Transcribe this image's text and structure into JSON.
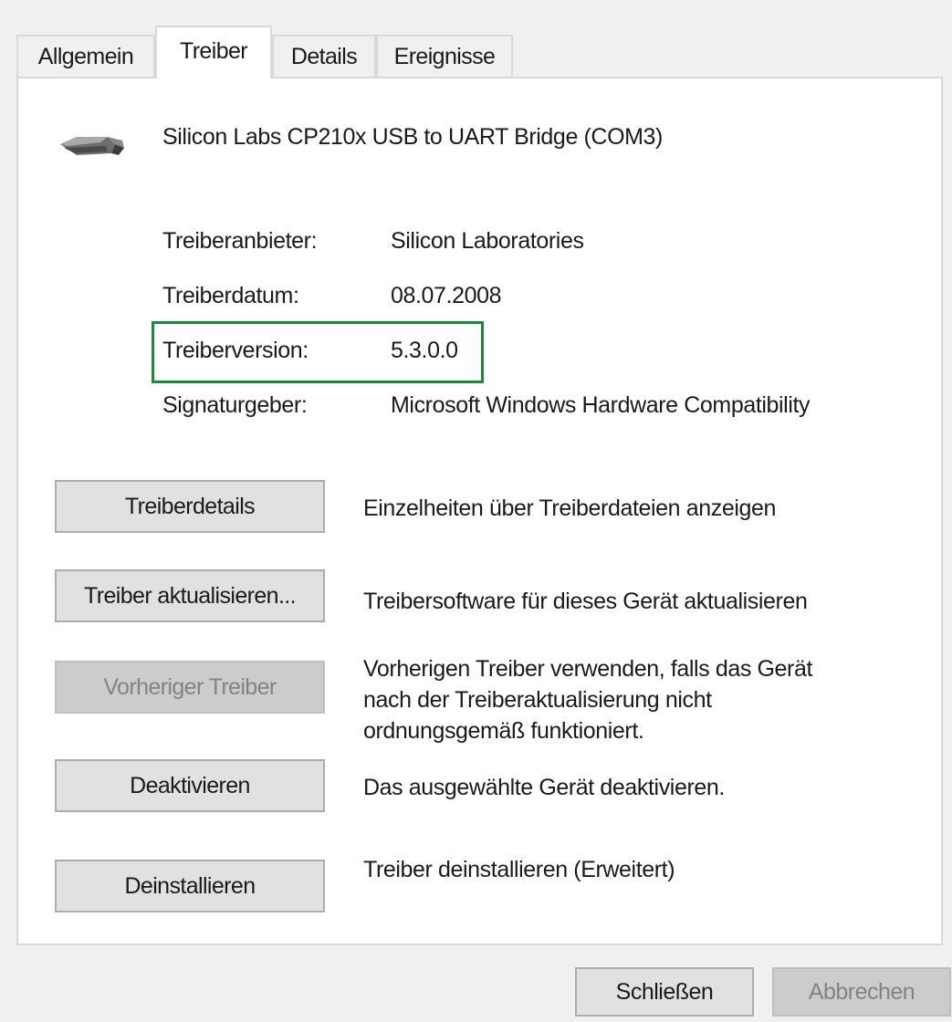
{
  "tabs": [
    {
      "label": "Allgemein"
    },
    {
      "label": "Treiber"
    },
    {
      "label": "Details"
    },
    {
      "label": "Ereignisse"
    }
  ],
  "active_tab": "Treiber",
  "device": {
    "icon": "serial-port-connector-icon",
    "name": "Silicon Labs CP210x USB to UART Bridge (COM3)"
  },
  "properties": [
    {
      "label": "Treiberanbieter:",
      "value": "Silicon Laboratories"
    },
    {
      "label": "Treiberdatum:",
      "value": "08.07.2008"
    },
    {
      "label": "Treiberversion:",
      "value": "5.3.0.0"
    },
    {
      "label": "Signaturgeber:",
      "value": "Microsoft Windows Hardware Compatibility"
    }
  ],
  "highlight_color": "#1a8a3a",
  "actions": [
    {
      "label": "Treiberdetails",
      "description": "Einzelheiten über Treiberdateien anzeigen",
      "enabled": true
    },
    {
      "label": "Treiber aktualisieren...",
      "description": "Treibersoftware für dieses Gerät aktualisieren",
      "enabled": true
    },
    {
      "label": "Vorheriger Treiber",
      "description_lines": [
        "Vorherigen Treiber verwenden, falls das Gerät",
        "nach der Treiberaktualisierung nicht",
        "ordnungsgemäß funktioniert."
      ],
      "enabled": false
    },
    {
      "label": "Deaktivieren",
      "description": "Das ausgewählte Gerät deaktivieren.",
      "enabled": true
    },
    {
      "label": "Deinstallieren",
      "description": "Treiber deinstallieren (Erweitert)",
      "enabled": true
    }
  ],
  "dialog_buttons": {
    "close": "Schließen",
    "cancel": "Abbrechen"
  }
}
